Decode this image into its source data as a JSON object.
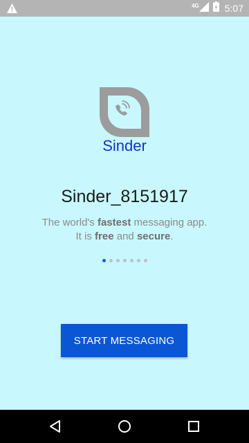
{
  "status_bar": {
    "time": "5:07",
    "network": "4G",
    "icons": [
      "warning-icon",
      "signal-icon",
      "battery-icon"
    ]
  },
  "app": {
    "brand_name": "Sinder",
    "title": "Sinder_8151917",
    "tagline_line1": {
      "pre": "The world's ",
      "bold": "fastest",
      "post": " messaging app."
    },
    "tagline_line2": {
      "pre": "It is ",
      "bold1": "free",
      "mid": " and ",
      "bold2": "secure",
      "post": "."
    },
    "page_indicator": {
      "total": 7,
      "active": 1
    },
    "start_button_label": "START MESSAGING"
  },
  "nav_bar": {
    "icons": [
      "back-icon",
      "home-icon",
      "recents-icon"
    ]
  },
  "colors": {
    "background": "#c8f8fe",
    "accent": "#0a56d4",
    "brand": "#1a2fc8",
    "status_bar": "#b4b4b4"
  }
}
